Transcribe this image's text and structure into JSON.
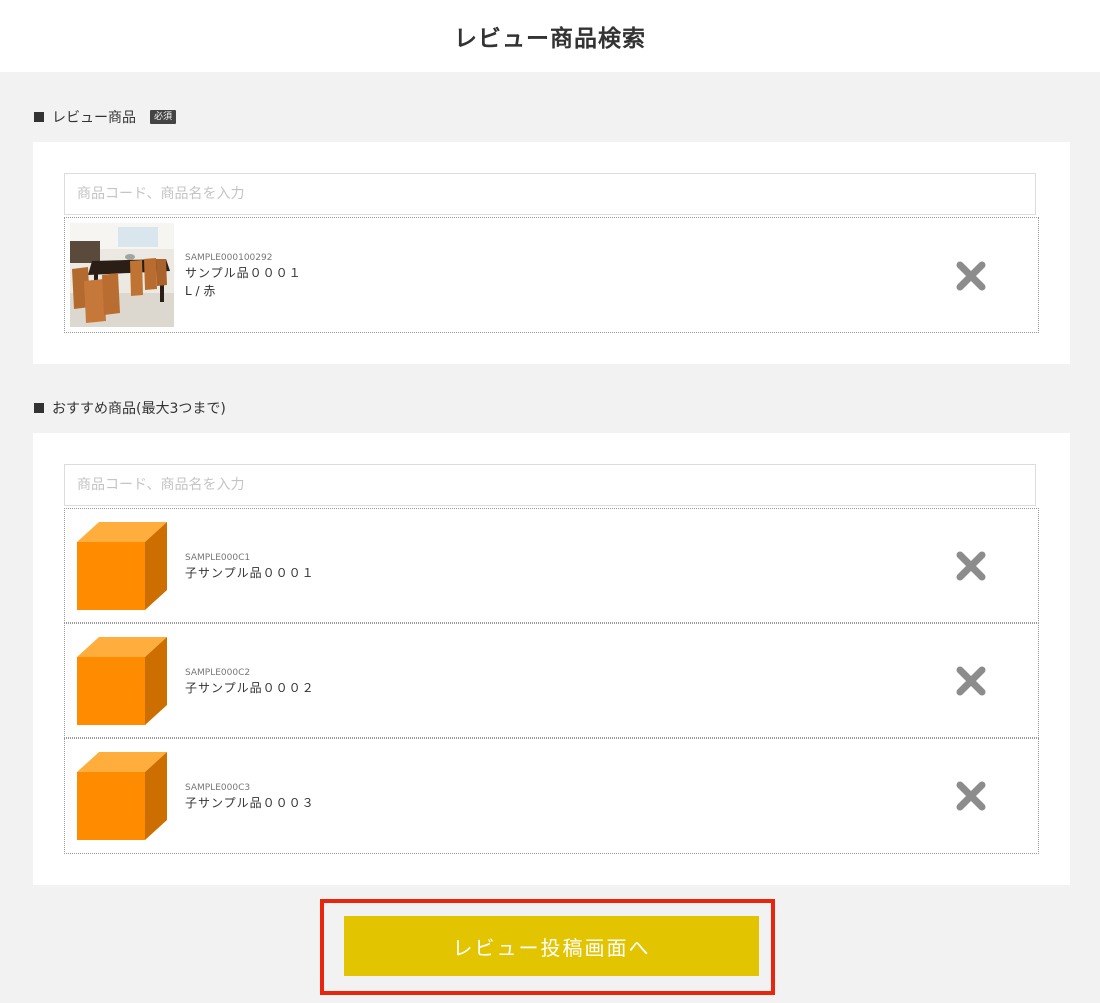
{
  "page": {
    "title": "レビュー商品検索"
  },
  "review_section": {
    "label": "レビュー商品",
    "required_badge": "必須",
    "search_placeholder": "商品コード、商品名を入力",
    "item": {
      "code": "SAMPLE000100292",
      "name": "サンプル品０００１",
      "variant": "L / 赤"
    }
  },
  "recommend_section": {
    "label": "おすすめ商品(最大3つまで)",
    "search_placeholder": "商品コード、商品名を入力",
    "items": [
      {
        "code": "SAMPLE000C1",
        "name": "子サンプル品０００１"
      },
      {
        "code": "SAMPLE000C2",
        "name": "子サンプル品０００２"
      },
      {
        "code": "SAMPLE000C3",
        "name": "子サンプル品０００３"
      }
    ]
  },
  "cta": {
    "label": "レビュー投稿画面へ"
  },
  "colors": {
    "background": "#f2f2f2",
    "cta": "#e2c400",
    "highlight": "#e8260e",
    "cube_front": "#ff8c00",
    "remove_icon": "#8c8c8c"
  },
  "icons": {
    "remove": "close-icon",
    "product_placeholder": "box-icon"
  }
}
